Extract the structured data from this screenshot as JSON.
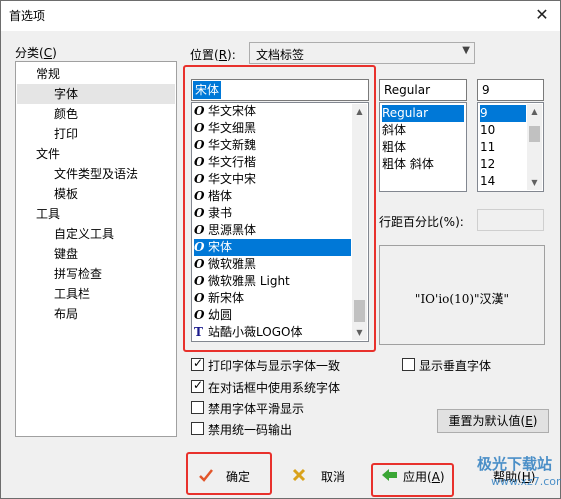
{
  "window": {
    "title": "首选项",
    "close_glyph": "✕"
  },
  "category": {
    "label": "分类(C)",
    "label_text": "分类(",
    "label_key": "C",
    "label_end": ")",
    "items": [
      "常规",
      "字体",
      "颜色",
      "打印",
      "文件",
      "文件类型及语法",
      "模板",
      "工具",
      "自定义工具",
      "键盘",
      "拼写检查",
      "工具栏",
      "布局"
    ],
    "selected": "字体"
  },
  "position": {
    "label_text": "位置(",
    "label_key": "R",
    "label_end": "):",
    "value": "文档标签"
  },
  "font": {
    "name_value": "宋体",
    "list": [
      {
        "icon": "O",
        "name": "华文宋体"
      },
      {
        "icon": "O",
        "name": "华文细黑"
      },
      {
        "icon": "O",
        "name": "华文新魏"
      },
      {
        "icon": "O",
        "name": "华文行楷"
      },
      {
        "icon": "O",
        "name": "华文中宋"
      },
      {
        "icon": "O",
        "name": "楷体"
      },
      {
        "icon": "O",
        "name": "隶书"
      },
      {
        "icon": "O",
        "name": "思源黑体"
      },
      {
        "icon": "O",
        "name": "宋体"
      },
      {
        "icon": "O",
        "name": "微软雅黑"
      },
      {
        "icon": "O",
        "name": "微软雅黑 Light"
      },
      {
        "icon": "O",
        "name": "新宋体"
      },
      {
        "icon": "O",
        "name": "幼圆"
      },
      {
        "icon": "T",
        "name": "站酷小薇LOGO体"
      }
    ],
    "selected_index": 8
  },
  "style": {
    "value": "Regular",
    "list": [
      "Regular",
      "斜体",
      "粗体",
      "粗体 斜体"
    ],
    "selected_index": 0
  },
  "size": {
    "value": "9",
    "list": [
      "9",
      "10",
      "11",
      "12",
      "14"
    ],
    "selected_index": 0
  },
  "line_spacing": {
    "label": "行距百分比(%):",
    "value": ""
  },
  "preview": {
    "text": "\"IO'io(10)\"汉漢\""
  },
  "options": [
    {
      "label": "打印字体与显示字体一致",
      "checked": true
    },
    {
      "label": "在对话框中使用系统字体",
      "checked": true
    },
    {
      "label": "禁用字体平滑显示",
      "checked": false
    },
    {
      "label": "禁用统一码输出",
      "checked": false
    }
  ],
  "vertical_font": {
    "label": "显示垂直字体",
    "checked": false
  },
  "reset_button": {
    "text": "重置为默认值(",
    "key": "E",
    "end": ")"
  },
  "buttons": {
    "ok": "确定",
    "cancel": "取消",
    "apply_text": "应用(",
    "apply_key": "A",
    "apply_end": ")",
    "help_text": "帮助(",
    "help_key": "H",
    "help_end": ")"
  },
  "watermark": {
    "line1": "极光下载站",
    "line2": "www.xz7.com"
  },
  "colors": {
    "highlight": "#0078d7",
    "annotation": "#e8312c",
    "tree_selected": "#e5e5e5"
  }
}
